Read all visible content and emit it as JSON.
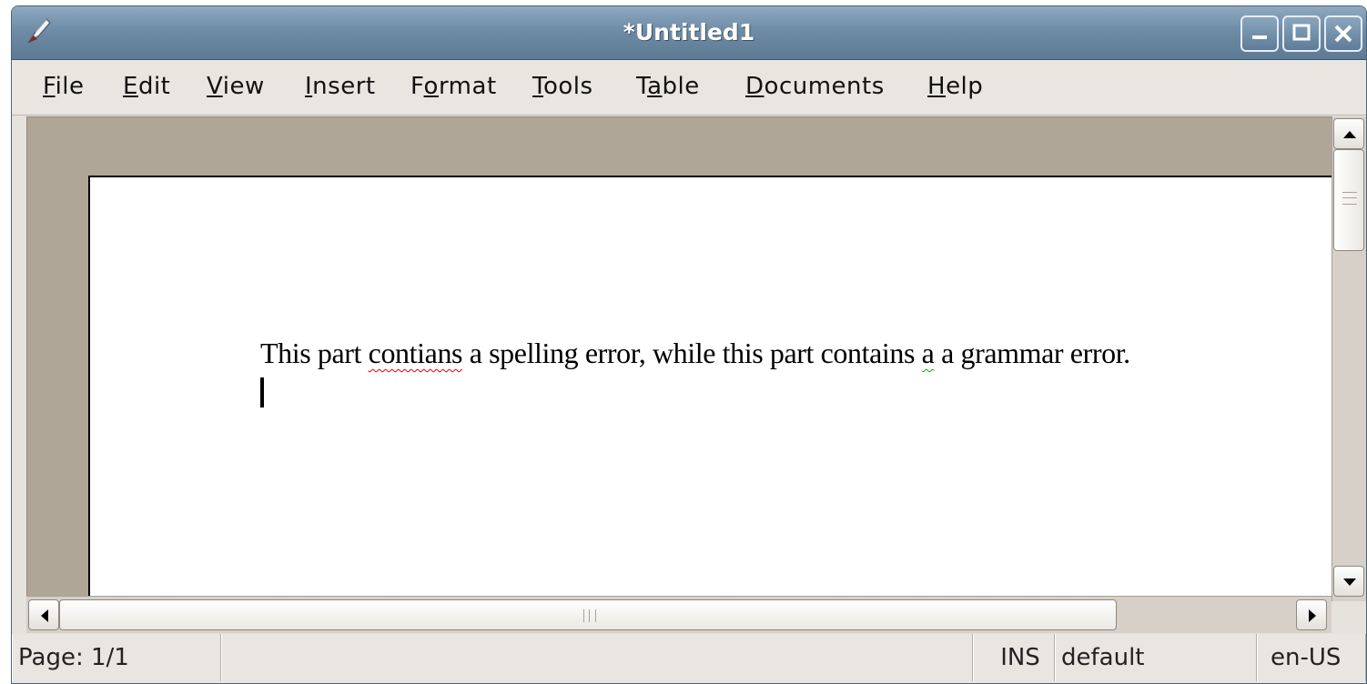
{
  "window": {
    "title": "*Untitled1",
    "icon": "quill-pen-icon",
    "controls": [
      "minimize-icon",
      "maximize-icon",
      "close-icon"
    ]
  },
  "menubar": {
    "items": [
      {
        "label": "File",
        "mnemonic": "F"
      },
      {
        "label": "Edit",
        "mnemonic": "E"
      },
      {
        "label": "View",
        "mnemonic": "V"
      },
      {
        "label": "Insert",
        "mnemonic": "I"
      },
      {
        "label": "Format",
        "mnemonic": "o"
      },
      {
        "label": "Tools",
        "mnemonic": "T"
      },
      {
        "label": "Table",
        "mnemonic": "a"
      },
      {
        "label": "Documents",
        "mnemonic": "D"
      },
      {
        "label": "Help",
        "mnemonic": "H"
      }
    ]
  },
  "document": {
    "text_before": "This part ",
    "spelling_error_word": "contians",
    "text_middle": " a spelling error, while this part contains ",
    "grammar_error_word": "a",
    "text_after": " a grammar error.",
    "spelling_underline_color": "#e00000",
    "grammar_underline_color": "#00b000"
  },
  "statusbar": {
    "page": "Page: 1/1",
    "message": "",
    "insert_mode": "INS",
    "style": "default",
    "language": "en-US"
  }
}
